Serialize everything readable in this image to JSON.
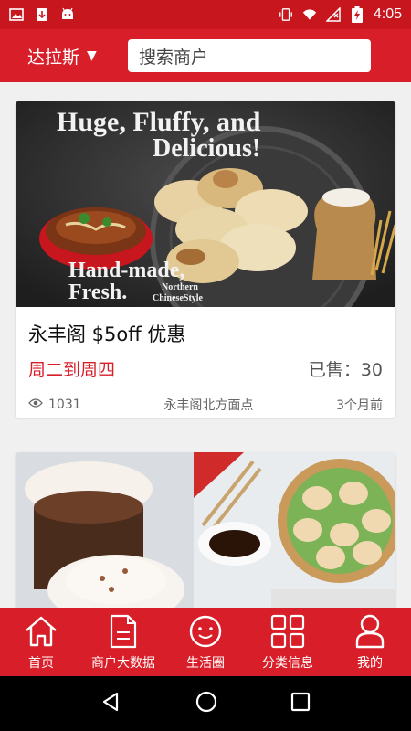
{
  "status_bar": {
    "time": "4:05",
    "icons_left": [
      "image-icon",
      "download-icon",
      "android-icon"
    ],
    "icons_right": [
      "vibrate-icon",
      "wifi-icon",
      "no-signal-icon",
      "battery-charging-icon"
    ]
  },
  "header": {
    "city": "达拉斯",
    "city_arrow": "▼",
    "search_placeholder": "搜索商户"
  },
  "deals": [
    {
      "title": "永丰阁 $5off 优惠",
      "days": "周二到周四",
      "sold": "已售：30",
      "views": "1031",
      "location": "永丰阁北方面点",
      "time_ago": "3个月前",
      "image_text": {
        "line1": "Huge, Fluffy, and",
        "line2": "Delicious!",
        "line3": "Hand-made,",
        "line4": "Fresh.",
        "badge_line1": "Northern",
        "badge_line2": "ChineseStyle"
      }
    }
  ],
  "bottom_nav": [
    {
      "label": "首页",
      "icon": "home-icon"
    },
    {
      "label": "商户大数据",
      "icon": "document-icon"
    },
    {
      "label": "生活圈",
      "icon": "smiley-circle-icon"
    },
    {
      "label": "分类信息",
      "icon": "grid-icon"
    },
    {
      "label": "我的",
      "icon": "user-icon"
    }
  ],
  "colors": {
    "brand_red": "#d81e28",
    "status_red": "#c8161e"
  }
}
